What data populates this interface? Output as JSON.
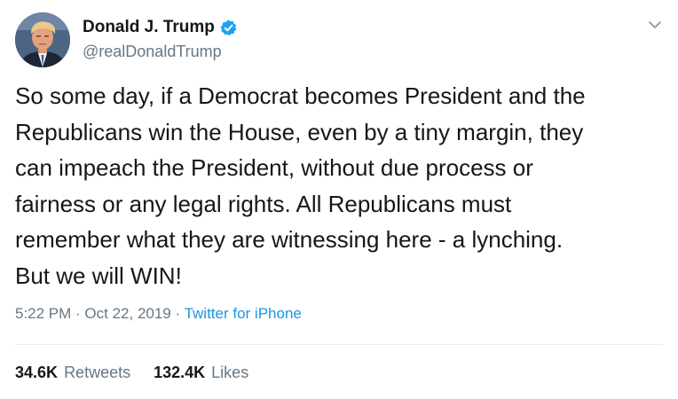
{
  "tweet": {
    "author": {
      "display_name": "Donald J. Trump",
      "handle": "@realDonaldTrump",
      "verified_icon": "verified-badge-icon",
      "avatar_icon": "profile-photo"
    },
    "text": "So some day, if a Democrat becomes President and the\nRepublicans win the House, even by a tiny margin, they\ncan impeach the President, without due process or\nfairness or any legal rights. All Republicans must\nremember what they are witnessing here - a lynching.\nBut we will WIN!",
    "time": "5:22 PM",
    "separator": " · ",
    "date": "Oct 22, 2019",
    "source": "Twitter for iPhone",
    "menu_icon": "chevron-down-icon",
    "stats": {
      "retweets_count": "34.6K",
      "retweets_label": "Retweets",
      "likes_count": "132.4K",
      "likes_label": "Likes"
    },
    "colors": {
      "text": "#14171a",
      "secondary": "#657786",
      "link": "#1b95e0",
      "verified": "#1da1f2",
      "divider": "#e6ecf0"
    }
  }
}
